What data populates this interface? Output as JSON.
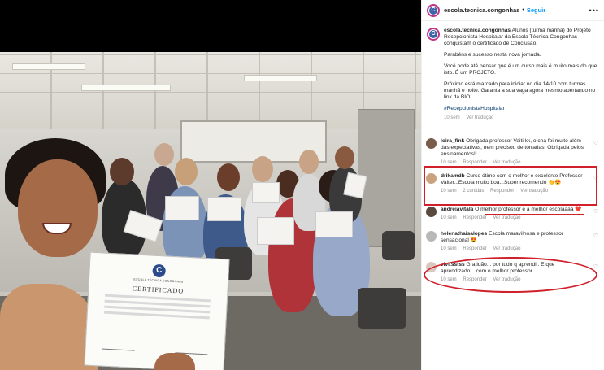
{
  "post": {
    "username": "escola.tecnica.congonhas",
    "separator": "•",
    "follow_label": "Seguir",
    "more_label": "•••"
  },
  "caption": {
    "username": "escola.tecnica.congonhas",
    "lines": [
      "Alunos (turma manhã) do Projeto Recepcionista Hospitalar da Escola Técnica Congonhas conquistam o certificado de Conclusão.",
      "Parabéns e sucesso nesta nova jornada.",
      "Você pode até pensar que é um curso mais é muito mais do que isto. É um PROJETO.",
      "Próximo está marcado para iniciar no dia 14/10 com turmas manhã e noite. Garanta a sua vaga agora mesmo apertando no link da BIO"
    ],
    "hashtag": "#RecepcionistaHospitalar",
    "time": "10 sem",
    "translate": "Ver tradução"
  },
  "comments": [
    {
      "username": "loira_fink",
      "text": "Obrigada professor Vaiti kk, o chá foi muito além das expectativas, nem precisou de torradas. Obrigada pelos ensinamentos!!",
      "time": "10 sem",
      "likes": "",
      "reply": "Responder",
      "translate": "Ver tradução",
      "avatar_color": "#7a5c4a"
    },
    {
      "username": "drikamdb",
      "text": "Curso ótimo com o melhor e excelente Professor Vaiter...Escola muito boa...Super recomendo 👏😍",
      "time": "10 sem",
      "likes": "2 curtidas",
      "reply": "Responder",
      "translate": "Ver tradução",
      "avatar_color": "#c9a27e"
    },
    {
      "username": "andreiavitala",
      "text": "O melhor professor e a melhor escolaaaa ❤️",
      "time": "10 sem",
      "likes": "",
      "reply": "Responder",
      "translate": "Ver tradução",
      "avatar_color": "#5a4a3e"
    },
    {
      "username": "helenathaisalopes",
      "text": "Escola maravilhosa e professor sensacional 😍",
      "time": "10 sem",
      "likes": "",
      "reply": "Responder",
      "translate": "Ver tradução",
      "avatar_color": "#b8b8b8"
    },
    {
      "username": "vivi.sstss",
      "text": "Gratidão... por tudo q aprendi.. E que aprendizado... com o melhor professor",
      "time": "10 sem",
      "likes": "",
      "reply": "Responder",
      "translate": "Ver tradução",
      "avatar_color": "#d8c8c0"
    }
  ],
  "certificate": {
    "logo": "C",
    "school": "ESCOLA TÉCNICA CONGONHAS",
    "title": "CERTIFICADO"
  },
  "colors": {
    "accent": "#0095f6",
    "highlight": "#d0202a",
    "hashtag": "#00376b"
  }
}
